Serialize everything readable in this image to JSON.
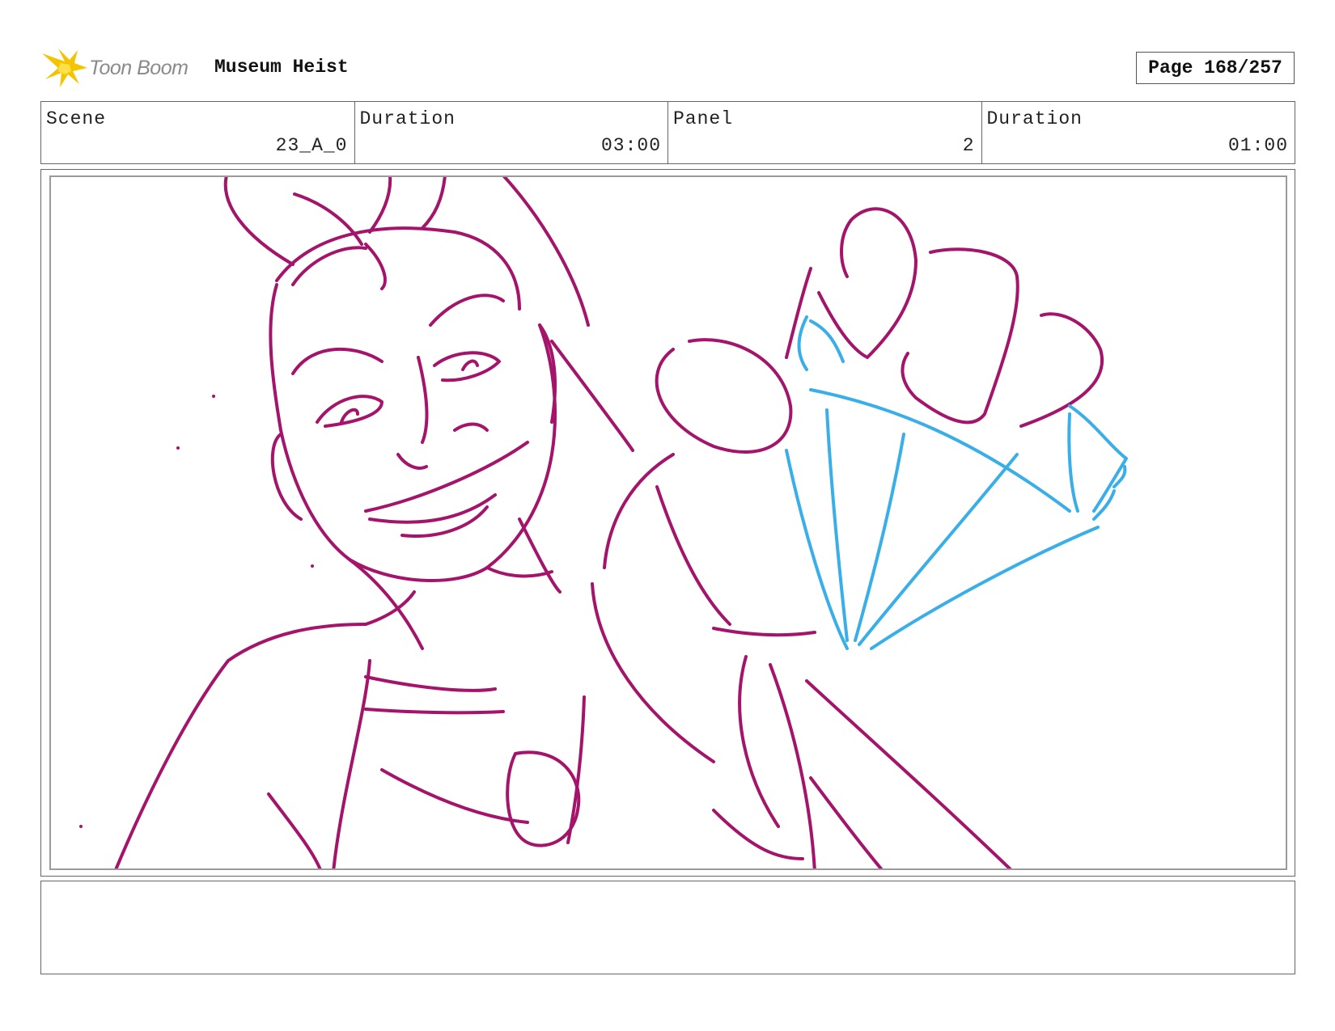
{
  "header": {
    "logo_text": "Toon Boom",
    "project_title": "Museum Heist",
    "page_label": "Page 168/257"
  },
  "info": {
    "scene_label": "Scene",
    "scene_value": "23_A_0",
    "scene_duration_label": "Duration",
    "scene_duration_value": "03:00",
    "panel_label": "Panel",
    "panel_value": "2",
    "panel_duration_label": "Duration",
    "panel_duration_value": "01:00"
  },
  "colors": {
    "character_line": "#a3146a",
    "gem_line": "#3aaee8",
    "logo_yellow": "#f5c400"
  },
  "notes": {
    "text": ""
  }
}
